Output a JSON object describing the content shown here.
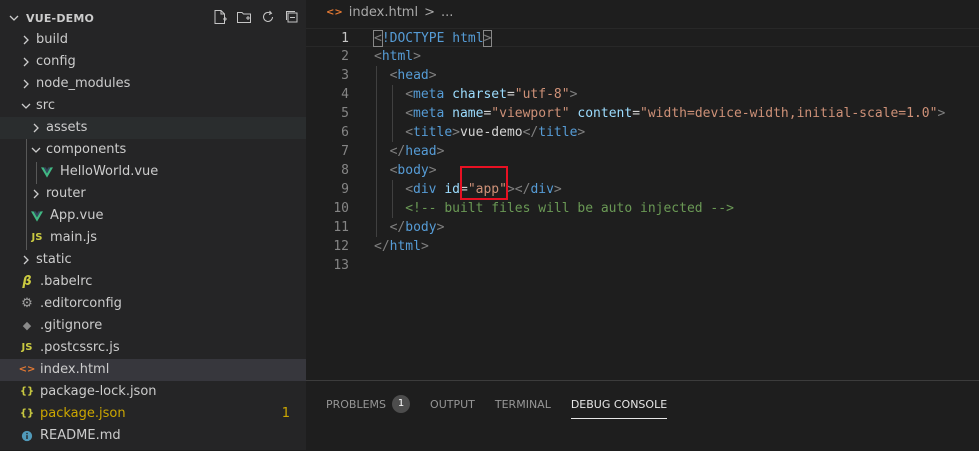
{
  "explorer": {
    "title": "VUE-DEMO",
    "actions": [
      "new-file-icon",
      "new-folder-icon",
      "refresh-icon",
      "collapse-all-icon"
    ],
    "items": [
      {
        "label": "build",
        "type": "folder",
        "expanded": false,
        "depth": 0
      },
      {
        "label": "config",
        "type": "folder",
        "expanded": false,
        "depth": 0
      },
      {
        "label": "node_modules",
        "type": "folder",
        "expanded": false,
        "depth": 0
      },
      {
        "label": "src",
        "type": "folder",
        "expanded": true,
        "depth": 0
      },
      {
        "label": "assets",
        "type": "folder",
        "expanded": false,
        "depth": 1
      },
      {
        "label": "components",
        "type": "folder",
        "expanded": true,
        "depth": 1
      },
      {
        "label": "HelloWorld.vue",
        "type": "vue",
        "depth": 2
      },
      {
        "label": "router",
        "type": "folder",
        "expanded": false,
        "depth": 1
      },
      {
        "label": "App.vue",
        "type": "vue",
        "depth": 1
      },
      {
        "label": "main.js",
        "type": "js",
        "depth": 1
      },
      {
        "label": "static",
        "type": "folder",
        "expanded": false,
        "depth": 0
      },
      {
        "label": ".babelrc",
        "type": "babel",
        "depth": 0
      },
      {
        "label": ".editorconfig",
        "type": "gear",
        "depth": 0
      },
      {
        "label": ".gitignore",
        "type": "git",
        "depth": 0
      },
      {
        "label": ".postcssrc.js",
        "type": "js",
        "depth": 0
      },
      {
        "label": "index.html",
        "type": "html",
        "depth": 0,
        "active": true
      },
      {
        "label": "package-lock.json",
        "type": "json",
        "depth": 0
      },
      {
        "label": "package.json",
        "type": "json",
        "depth": 0,
        "modified": true,
        "badge": "1"
      },
      {
        "label": "README.md",
        "type": "info",
        "depth": 0
      }
    ]
  },
  "breadcrumb": {
    "file": "index.html",
    "sep": ">",
    "more": "..."
  },
  "editor": {
    "current_line": 1,
    "lines": [
      {
        "n": "1",
        "indent": 0,
        "tokens": [
          [
            "punc",
            "<"
          ],
          [
            "tag",
            "!DOCTYPE"
          ],
          [
            "plain",
            " "
          ],
          [
            "tag",
            "html"
          ],
          [
            "punc",
            ">"
          ]
        ]
      },
      {
        "n": "2",
        "indent": 0,
        "tokens": [
          [
            "punc",
            "<"
          ],
          [
            "tag",
            "html"
          ],
          [
            "punc",
            ">"
          ]
        ]
      },
      {
        "n": "3",
        "indent": 1,
        "tokens": [
          [
            "punc",
            "<"
          ],
          [
            "tag",
            "head"
          ],
          [
            "punc",
            ">"
          ]
        ]
      },
      {
        "n": "4",
        "indent": 2,
        "tokens": [
          [
            "punc",
            "<"
          ],
          [
            "tag",
            "meta"
          ],
          [
            "plain",
            " "
          ],
          [
            "attr",
            "charset"
          ],
          [
            "plain",
            "="
          ],
          [
            "str",
            "\"utf-8\""
          ],
          [
            "punc",
            ">"
          ]
        ]
      },
      {
        "n": "5",
        "indent": 2,
        "tokens": [
          [
            "punc",
            "<"
          ],
          [
            "tag",
            "meta"
          ],
          [
            "plain",
            " "
          ],
          [
            "attr",
            "name"
          ],
          [
            "plain",
            "="
          ],
          [
            "str",
            "\"viewport\""
          ],
          [
            "plain",
            " "
          ],
          [
            "attr",
            "content"
          ],
          [
            "plain",
            "="
          ],
          [
            "str",
            "\"width=device-width,initial-scale=1.0\""
          ],
          [
            "punc",
            ">"
          ]
        ]
      },
      {
        "n": "6",
        "indent": 2,
        "tokens": [
          [
            "punc",
            "<"
          ],
          [
            "tag",
            "title"
          ],
          [
            "punc",
            ">"
          ],
          [
            "plain",
            "vue-demo"
          ],
          [
            "punc",
            "</"
          ],
          [
            "tag",
            "title"
          ],
          [
            "punc",
            ">"
          ]
        ]
      },
      {
        "n": "7",
        "indent": 1,
        "tokens": [
          [
            "punc",
            "</"
          ],
          [
            "tag",
            "head"
          ],
          [
            "punc",
            ">"
          ]
        ]
      },
      {
        "n": "8",
        "indent": 1,
        "tokens": [
          [
            "punc",
            "<"
          ],
          [
            "tag",
            "body"
          ],
          [
            "punc",
            ">"
          ]
        ]
      },
      {
        "n": "9",
        "indent": 2,
        "tokens": [
          [
            "punc",
            "<"
          ],
          [
            "tag",
            "div"
          ],
          [
            "plain",
            " "
          ],
          [
            "attr",
            "id"
          ],
          [
            "plain",
            "="
          ],
          [
            "str",
            "\"app\""
          ],
          [
            "punc",
            "></"
          ],
          [
            "tag",
            "div"
          ],
          [
            "punc",
            ">"
          ]
        ]
      },
      {
        "n": "10",
        "indent": 2,
        "tokens": [
          [
            "cmt",
            "<!-- built files will be auto injected -->"
          ]
        ]
      },
      {
        "n": "11",
        "indent": 1,
        "tokens": [
          [
            "punc",
            "</"
          ],
          [
            "tag",
            "body"
          ],
          [
            "punc",
            ">"
          ]
        ]
      },
      {
        "n": "12",
        "indent": 0,
        "tokens": [
          [
            "punc",
            "</"
          ],
          [
            "tag",
            "html"
          ],
          [
            "punc",
            ">"
          ]
        ]
      },
      {
        "n": "13",
        "indent": 0,
        "tokens": []
      }
    ]
  },
  "panel": {
    "tabs": [
      {
        "label": "PROBLEMS",
        "badge": "1",
        "active": false
      },
      {
        "label": "OUTPUT",
        "active": false
      },
      {
        "label": "TERMINAL",
        "active": false
      },
      {
        "label": "DEBUG CONSOLE",
        "active": true
      }
    ]
  },
  "colors": {
    "accent_highlight": "#e81123",
    "modified": "#cca700",
    "vue": "#41b883",
    "js": "#cbcb41",
    "html": "#e37933"
  }
}
